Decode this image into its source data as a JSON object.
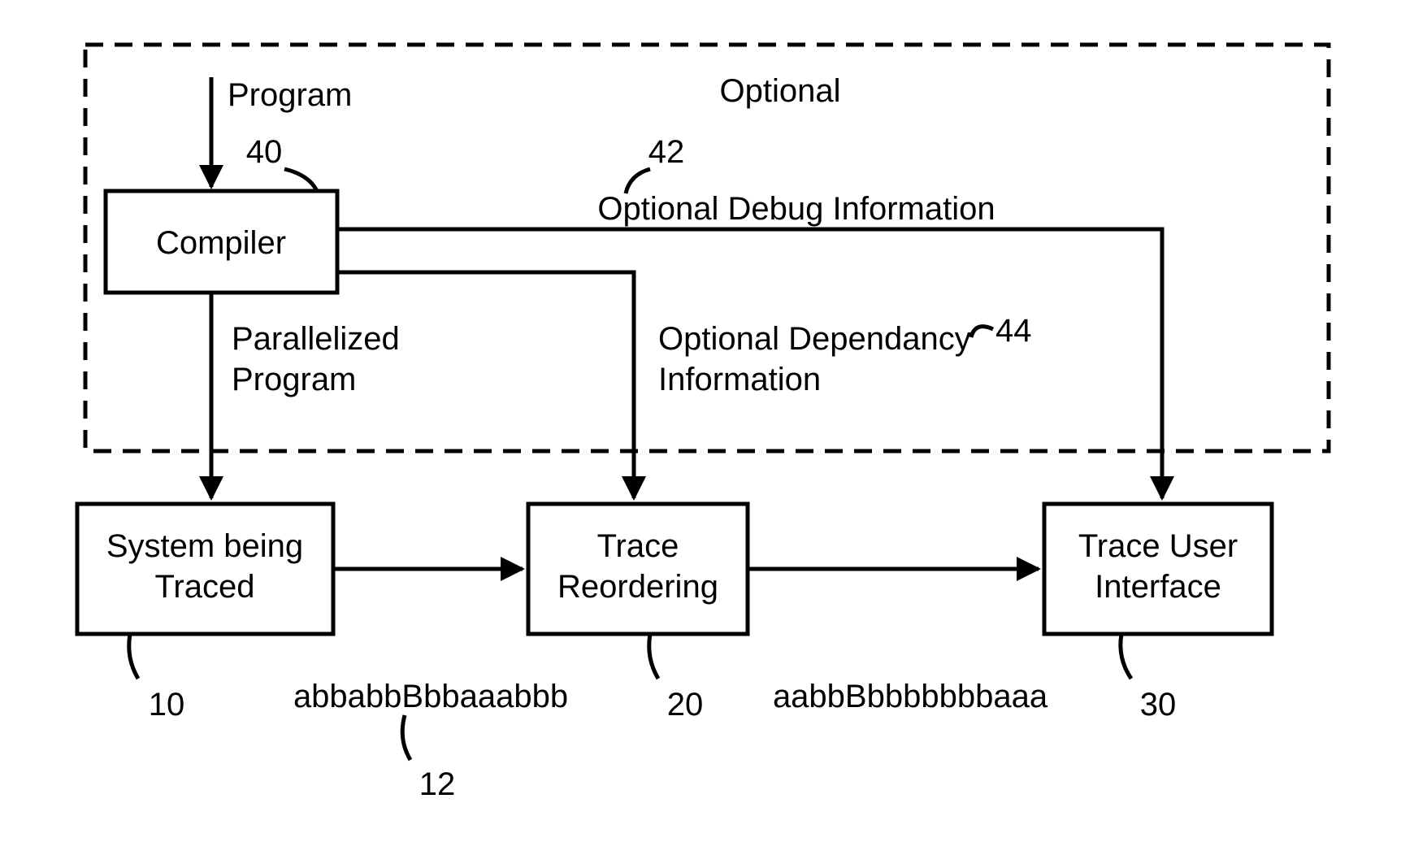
{
  "labels": {
    "optional": "Optional",
    "program": "Program",
    "compiler": "Compiler",
    "parallelized_l1": "Parallelized",
    "parallelized_l2": "Program",
    "debug_info": "Optional Debug Information",
    "dep_info_l1": "Optional Dependancy",
    "dep_info_l2": "Information",
    "system_l1": "System being",
    "system_l2": "Traced",
    "reorder_l1": "Trace",
    "reorder_l2": "Reordering",
    "ui_l1": "Trace User",
    "ui_l2": "Interface",
    "trace_in": "abbabbBbbaaabbb",
    "trace_out": "aabbBbbbbbbbaaa"
  },
  "refs": {
    "r10": "10",
    "r12": "12",
    "r20": "20",
    "r30": "30",
    "r40": "40",
    "r42": "42",
    "r44": "44"
  }
}
